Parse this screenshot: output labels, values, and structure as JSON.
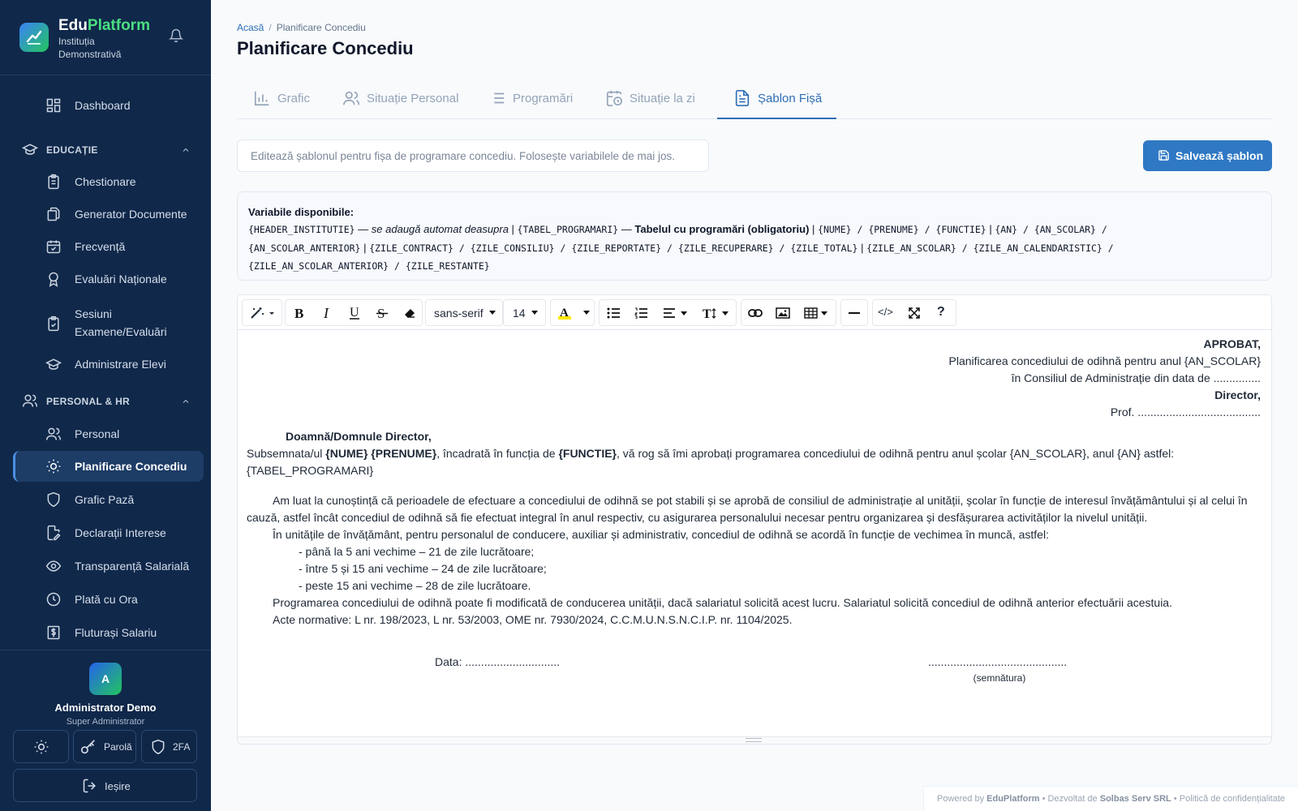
{
  "brand": {
    "name_a": "Edu",
    "name_b": "Platform",
    "institution": "Instituția Demonstrativă"
  },
  "sidebar": {
    "dashboard": "Dashboard",
    "section_edu": "EDUCAȚIE",
    "edu_items": [
      "Chestionare",
      "Generator Documente",
      "Frecvență",
      "Evaluări Naționale",
      "Sesiuni Examene/Evaluări",
      "Administrare Elevi"
    ],
    "section_hr": "PERSONAL & HR",
    "hr_items": [
      "Personal",
      "Planificare Concediu",
      "Grafic Pază",
      "Declarații Interese",
      "Transparență Salarială",
      "Plată cu Ora",
      "Fluturași Salariu"
    ]
  },
  "user": {
    "initial": "A",
    "name": "Administrator Demo",
    "role": "Super Administrator",
    "password_label": "Parolă",
    "twofa_label": "2FA",
    "logout_label": "Ieșire"
  },
  "breadcrumb": {
    "home": "Acasă",
    "separator": "/",
    "current": "Planificare Concediu"
  },
  "page_title": "Planificare Concediu",
  "tabs": [
    "Grafic",
    "Situație Personal",
    "Programări",
    "Situație la zi",
    "Șablon Fișă"
  ],
  "description_placeholder": "Editează șablonul pentru fișa de programare concediu. Folosește variabilele de mai jos.",
  "save_label": "Salvează șablon",
  "variables": {
    "heading": "Variabile disponibile:",
    "line1": [
      {
        "t": "{HEADER_INSTITUTIE}",
        "s": "m"
      },
      {
        "t": " — ",
        "s": ""
      },
      {
        "t": "se adaugă automat deasupra",
        "s": "i"
      },
      {
        "t": "  |  ",
        "s": ""
      },
      {
        "t": "{TABEL_PROGRAMARI}",
        "s": "m"
      },
      {
        "t": " — ",
        "s": ""
      },
      {
        "t": "Tabelul cu programări (obligatoriu)",
        "s": "b"
      },
      {
        "t": "  |  ",
        "s": ""
      },
      {
        "t": "{NUME} / {PRENUME} / {FUNCTIE}",
        "s": "m"
      },
      {
        "t": "  |  ",
        "s": ""
      },
      {
        "t": "{AN} / {AN_SCOLAR} /",
        "s": "m"
      }
    ],
    "line2": [
      {
        "t": "{AN_SCOLAR_ANTERIOR}",
        "s": "m"
      },
      {
        "t": "  |  ",
        "s": ""
      },
      {
        "t": "{ZILE_CONTRACT} / {ZILE_CONSILIU} / {ZILE_REPORTATE} / {ZILE_RECUPERARE} / {ZILE_TOTAL}",
        "s": "m"
      },
      {
        "t": "  |  ",
        "s": ""
      },
      {
        "t": "{ZILE_AN_SCOLAR} / {ZILE_AN_CALENDARISTIC} /",
        "s": "m"
      }
    ],
    "line3": [
      {
        "t": "{ZILE_AN_SCOLAR_ANTERIOR} / {ZILE_RESTANTE}",
        "s": "m"
      }
    ]
  },
  "toolbar": {
    "font_family": "sans-serif",
    "font_size": "14",
    "help": "?",
    "code": "</>"
  },
  "document": {
    "approved": "APROBAT,",
    "approved_line1": "Planificarea concediului de odihnă pentru anul {AN_SCOLAR}",
    "approved_line2": "în Consiliul de Administrație din data de ...............",
    "director": "Director,",
    "prof": "Prof. .......................................",
    "salutation": "Doamnă/Domnule Director,",
    "request_a": "Subsemnata/ul ",
    "request_b": "{NUME} {PRENUME}",
    "request_c": ", încadrată în funcția de ",
    "request_d": "{FUNCTIE}",
    "request_e": ", vă rog să îmi aprobați programarea concediului de odihnă pentru anul școlar {AN_SCOLAR}, anul {AN} astfel:",
    "table_var": "{TABEL_PROGRAMARI}",
    "para1_l1": "Am luat la cunoștință că perioadele de efectuare a concediului de odihnă se pot stabili și se aprobă de consiliul de administrație al unității, școlar în funcție de interesul învățământului și al celui în",
    "para1_l2": "cauză, astfel încât concediul de odihnă să fie efectuat integral în anul respectiv, cu asigurarea personalului necesar pentru organizarea și desfășurarea activităților la nivelul unității.",
    "para2": "În unitățile de învățământ, pentru personalul de conducere, auxiliar și administrativ, concediul de odihnă se acordă în funcție de vechimea în muncă, astfel:",
    "bullets": [
      "- până la 5 ani vechime – 21 de zile lucrătoare;",
      "- între 5 și 15 ani vechime – 24 de zile lucrătoare;",
      "- peste 15 ani vechime – 28 de zile lucrătoare."
    ],
    "para3": "Programarea concediului de odihnă poate fi modificată de conducerea unității, dacă salariatul solicită acest lucru. Salariatul solicită concediul de odihnă anterior efectuării acestuia.",
    "para4": "Acte normative: L nr. 198/2023, L nr. 53/2003, OME nr. 7930/2024, C.C.M.U.N.S.N.C.I.P. nr. 1104/2025.",
    "date": "Data: ..............................",
    "signature_dots": "............................................",
    "signature_label": "(semnătura)"
  },
  "footer": {
    "a": "Powered by ",
    "b": "EduPlatform",
    "c": " • Dezvoltat de ",
    "d": "Solbas Serv SRL",
    "e": " • Politică de confidențialitate"
  }
}
